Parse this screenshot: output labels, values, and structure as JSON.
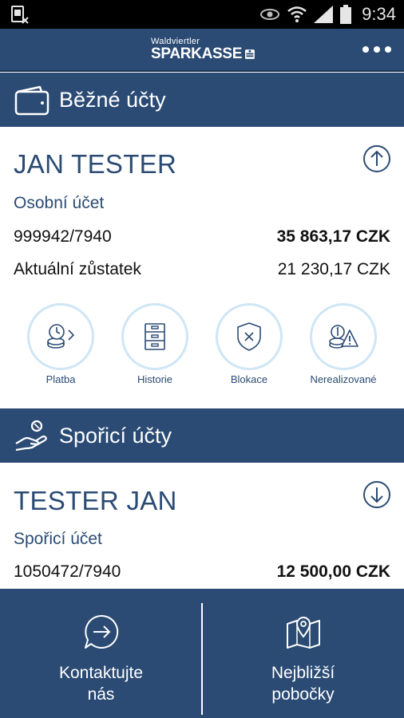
{
  "status_bar": {
    "time": "9:34"
  },
  "header": {
    "brand_small": "Waldviertler",
    "brand_big": "SPARKASSE"
  },
  "current_accounts": {
    "section_title": "Běžné účty",
    "holder": "JAN TESTER",
    "account_type": "Osobní účet",
    "account_number": "999942/7940",
    "balance": "35 863,17 CZK",
    "current_balance_label": "Aktuální zůstatek",
    "current_balance": "21 230,17 CZK",
    "actions": [
      {
        "label": "Platba"
      },
      {
        "label": "Historie"
      },
      {
        "label": "Blokace"
      },
      {
        "label": "Nerealizované"
      }
    ]
  },
  "savings_accounts": {
    "section_title": "Spořicí účty",
    "holder": "TESTER JAN",
    "account_type": "Spořicí účet",
    "account_number": "1050472/7940",
    "balance": "12 500,00 CZK"
  },
  "bottom_nav": {
    "contact_line1": "Kontaktujte",
    "contact_line2": "nás",
    "branches_line1": "Nejbližší",
    "branches_line2": "pobočky"
  },
  "colors": {
    "primary": "#2b4b74",
    "ring": "#cfe6f5"
  }
}
